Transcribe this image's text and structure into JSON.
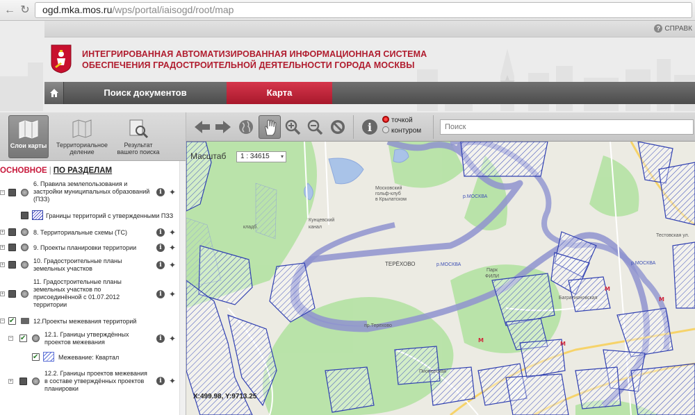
{
  "browser": {
    "url_domain": "ogd.mka.mos.ru",
    "url_path": "/wps/portal/iaisogd/root/map"
  },
  "header": {
    "help_label": "СПРАВК",
    "title_line1": "ИНТЕГРИРОВАННАЯ АВТОМАТИЗИРОВАННАЯ ИНФОРМАЦИОННАЯ СИСТЕМА",
    "title_line2": "ОБЕСПЕЧЕНИЯ ГРАДОСТРОИТЕЛЬНОЙ ДЕЯТЕЛЬНОСТИ ГОРОДА МОСКВЫ",
    "tabs": [
      {
        "label": "Поиск документов"
      },
      {
        "label": "Карта",
        "active": true
      }
    ],
    "accent_color": "#b01c2e"
  },
  "left_panel": {
    "buttons": {
      "layers": "Слои карты",
      "territorial_1": "Территориальное",
      "territorial_2": "деление",
      "result_1": "Результат",
      "result_2": "вашего поиска"
    },
    "mode": {
      "main": "ОСНОВНОЕ",
      "sep": "|",
      "sections": "ПО РАЗДЕЛАМ"
    },
    "layers": [
      {
        "l1": "6. Правила землепользования и",
        "l2": "застройки муниципальных образований",
        "l3": "(ПЗЗ)"
      },
      {
        "l1": "Границы территорий с утвержденными ПЗЗ"
      },
      {
        "l1": "8. Территориальные схемы (ТС)"
      },
      {
        "l1": "9. Проекты планировки территории"
      },
      {
        "l1": "10. Градостроительные планы",
        "l2": "земельных участков"
      },
      {
        "l1": "11. Градостроительные планы",
        "l2": "земельных участков по",
        "l3": "присоединённой с 01.07.2012",
        "l4": "территории"
      },
      {
        "l1": "12.Проекты межевания территорий"
      },
      {
        "l1": "12.1. Границы утверждённых",
        "l2": "проектов межевания"
      },
      {
        "l1": "Межевание: Квартал"
      },
      {
        "l1": "12.2. Границы проектов межевания",
        "l2": "в составе утверждённых проектов",
        "l3": "планировки"
      }
    ]
  },
  "toolbar": {
    "point_label": "точкой",
    "contour_label": "контуром",
    "select_mode": "точкой",
    "search_placeholder": "Поиск"
  },
  "map": {
    "scale_label": "Масштаб",
    "scale_value": "1 : 34615",
    "coords": "X:499.98, Y:9713.25",
    "labels": {
      "terekhovo": "ТЕРЁХОВО",
      "park_fili": "Парк",
      "park_fili2": "ФИЛИ",
      "moskva1": "р.МОСКВА",
      "moskva2": "р.МОСКВА",
      "moskva3": "р.МОСКВА",
      "golf1": "Московский",
      "golf2": "гольф-клуб",
      "golf3": "в Крылатском",
      "kanal": "канал",
      "kladb": "кладб.",
      "tokar": "Тестовская ул.",
      "pionerskaya": "Пионерская",
      "bagrationovskaya": "Багратионовская",
      "kuntsevsky": "Кунцевский",
      "terekhovo_st": "пр.Терехово"
    }
  }
}
